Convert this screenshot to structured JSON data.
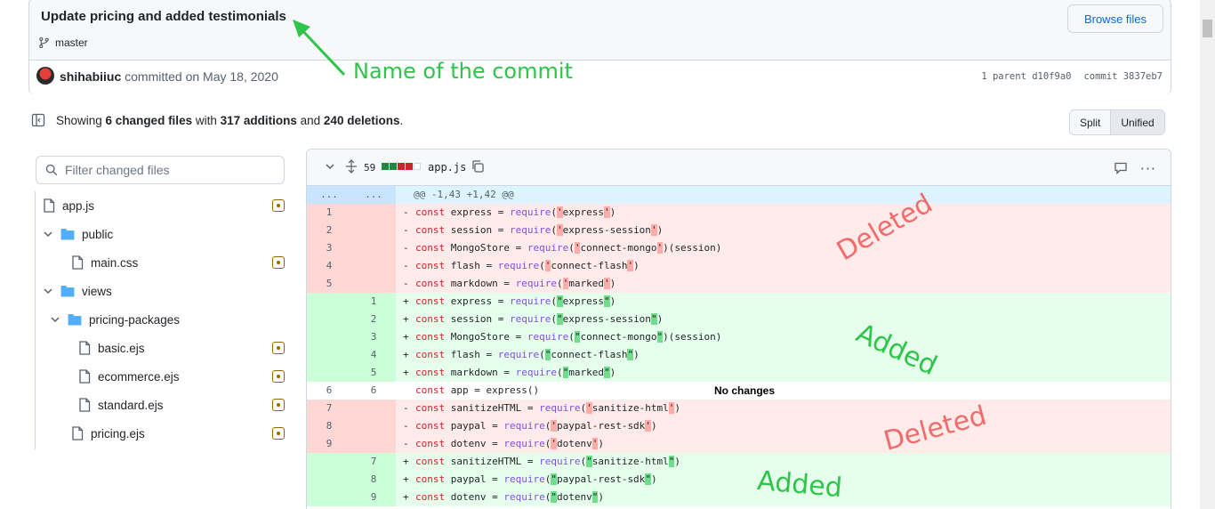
{
  "commit": {
    "title": "Update pricing and added testimonials",
    "branch": "master",
    "browse_label": "Browse files",
    "author": "shihabiiuc",
    "committed_text": " committed on May 18, 2020",
    "parent_text": "1 parent d10f9a0",
    "commit_text": "commit 3837eb7"
  },
  "annotations": {
    "commit_name": "Name of the commit",
    "deleted": "Deleted",
    "added": "Added",
    "no_changes": "No changes"
  },
  "summary": {
    "prefix": "Showing ",
    "files": "6 changed files",
    "with": " with ",
    "additions": "317 additions",
    "and": " and ",
    "deletions": "240 deletions",
    "suffix": "."
  },
  "view_toggle": {
    "split": "Split",
    "unified": "Unified"
  },
  "file_filter": {
    "placeholder": "Filter changed files"
  },
  "file_tree": [
    {
      "label": "app.js",
      "type": "file",
      "changed": true
    },
    {
      "label": "public",
      "type": "folder"
    },
    {
      "label": "main.css",
      "type": "file",
      "changed": true
    },
    {
      "label": "views",
      "type": "folder"
    },
    {
      "label": "pricing-packages",
      "type": "folder"
    },
    {
      "label": "basic.ejs",
      "type": "file",
      "changed": true
    },
    {
      "label": "ecommerce.ejs",
      "type": "file",
      "changed": true
    },
    {
      "label": "standard.ejs",
      "type": "file",
      "changed": true
    },
    {
      "label": "pricing.ejs",
      "type": "file",
      "changed": true
    }
  ],
  "diff": {
    "count": "59",
    "filename": "app.js",
    "hunk_dots": "...",
    "hunk": "@@ -1,43 +1,42 @@",
    "lines": [
      {
        "t": "del",
        "o": "1",
        "n": "",
        "sign": "-",
        "v": "const",
        "var": " express = ",
        "fn": "require",
        "a": "(",
        "q": "'",
        "s": "express",
        "q2": "'",
        "z": ")"
      },
      {
        "t": "del",
        "o": "2",
        "n": "",
        "sign": "-",
        "v": "const",
        "var": " session = ",
        "fn": "require",
        "a": "(",
        "q": "'",
        "s": "express-session",
        "q2": "'",
        "z": ")"
      },
      {
        "t": "del",
        "o": "3",
        "n": "",
        "sign": "-",
        "v": "const",
        "var": " MongoStore = ",
        "fn": "require",
        "a": "(",
        "q": "'",
        "s": "connect-mongo",
        "q2": "'",
        "z": ")(session)"
      },
      {
        "t": "del",
        "o": "4",
        "n": "",
        "sign": "-",
        "v": "const",
        "var": " flash = ",
        "fn": "require",
        "a": "(",
        "q": "'",
        "s": "connect-flash",
        "q2": "'",
        "z": ")"
      },
      {
        "t": "del",
        "o": "5",
        "n": "",
        "sign": "-",
        "v": "const",
        "var": " markdown = ",
        "fn": "require",
        "a": "(",
        "q": "'",
        "s": "marked",
        "q2": "'",
        "z": ")"
      },
      {
        "t": "add",
        "o": "",
        "n": "1",
        "sign": "+",
        "v": "const",
        "var": " express = ",
        "fn": "require",
        "a": "(",
        "q": "\"",
        "s": "express",
        "q2": "\"",
        "z": ")"
      },
      {
        "t": "add",
        "o": "",
        "n": "2",
        "sign": "+",
        "v": "const",
        "var": " session = ",
        "fn": "require",
        "a": "(",
        "q": "\"",
        "s": "express-session",
        "q2": "\"",
        "z": ")"
      },
      {
        "t": "add",
        "o": "",
        "n": "3",
        "sign": "+",
        "v": "const",
        "var": " MongoStore = ",
        "fn": "require",
        "a": "(",
        "q": "\"",
        "s": "connect-mongo",
        "q2": "\"",
        "z": ")(session)"
      },
      {
        "t": "add",
        "o": "",
        "n": "4",
        "sign": "+",
        "v": "const",
        "var": " flash = ",
        "fn": "require",
        "a": "(",
        "q": "\"",
        "s": "connect-flash",
        "q2": "\"",
        "z": ")"
      },
      {
        "t": "add",
        "o": "",
        "n": "5",
        "sign": "+",
        "v": "const",
        "var": " markdown = ",
        "fn": "require",
        "a": "(",
        "q": "\"",
        "s": "marked",
        "q2": "\"",
        "z": ")"
      },
      {
        "t": "ctx",
        "o": "6",
        "n": "6",
        "sign": " ",
        "v": "const",
        "var": " app = express()",
        "fn": "",
        "a": "",
        "q": "",
        "s": "",
        "q2": "",
        "z": ""
      },
      {
        "t": "del",
        "o": "7",
        "n": "",
        "sign": "-",
        "v": "const",
        "var": " sanitizeHTML = ",
        "fn": "require",
        "a": "(",
        "q": "'",
        "s": "sanitize-html",
        "q2": "'",
        "z": ")"
      },
      {
        "t": "del",
        "o": "8",
        "n": "",
        "sign": "-",
        "v": "const",
        "var": " paypal = ",
        "fn": "require",
        "a": "(",
        "q": "'",
        "s": "paypal-rest-sdk",
        "q2": "'",
        "z": ")"
      },
      {
        "t": "del",
        "o": "9",
        "n": "",
        "sign": "-",
        "v": "const",
        "var": " dotenv = ",
        "fn": "require",
        "a": "(",
        "q": "'",
        "s": "dotenv",
        "q2": "'",
        "z": ")"
      },
      {
        "t": "add",
        "o": "",
        "n": "7",
        "sign": "+",
        "v": "const",
        "var": " sanitizeHTML = ",
        "fn": "require",
        "a": "(",
        "q": "\"",
        "s": "sanitize-html",
        "q2": "\"",
        "z": ")"
      },
      {
        "t": "add",
        "o": "",
        "n": "8",
        "sign": "+",
        "v": "const",
        "var": " paypal = ",
        "fn": "require",
        "a": "(",
        "q": "\"",
        "s": "paypal-rest-sdk",
        "q2": "\"",
        "z": ")"
      },
      {
        "t": "add",
        "o": "",
        "n": "9",
        "sign": "+",
        "v": "const",
        "var": " dotenv = ",
        "fn": "require",
        "a": "(",
        "q": "\"",
        "s": "dotenv",
        "q2": "\"",
        "z": ")"
      }
    ]
  },
  "colors": {
    "annotation_green": "#2fc44a",
    "annotation_red": "#f26a6a",
    "link_blue": "#0969da"
  }
}
